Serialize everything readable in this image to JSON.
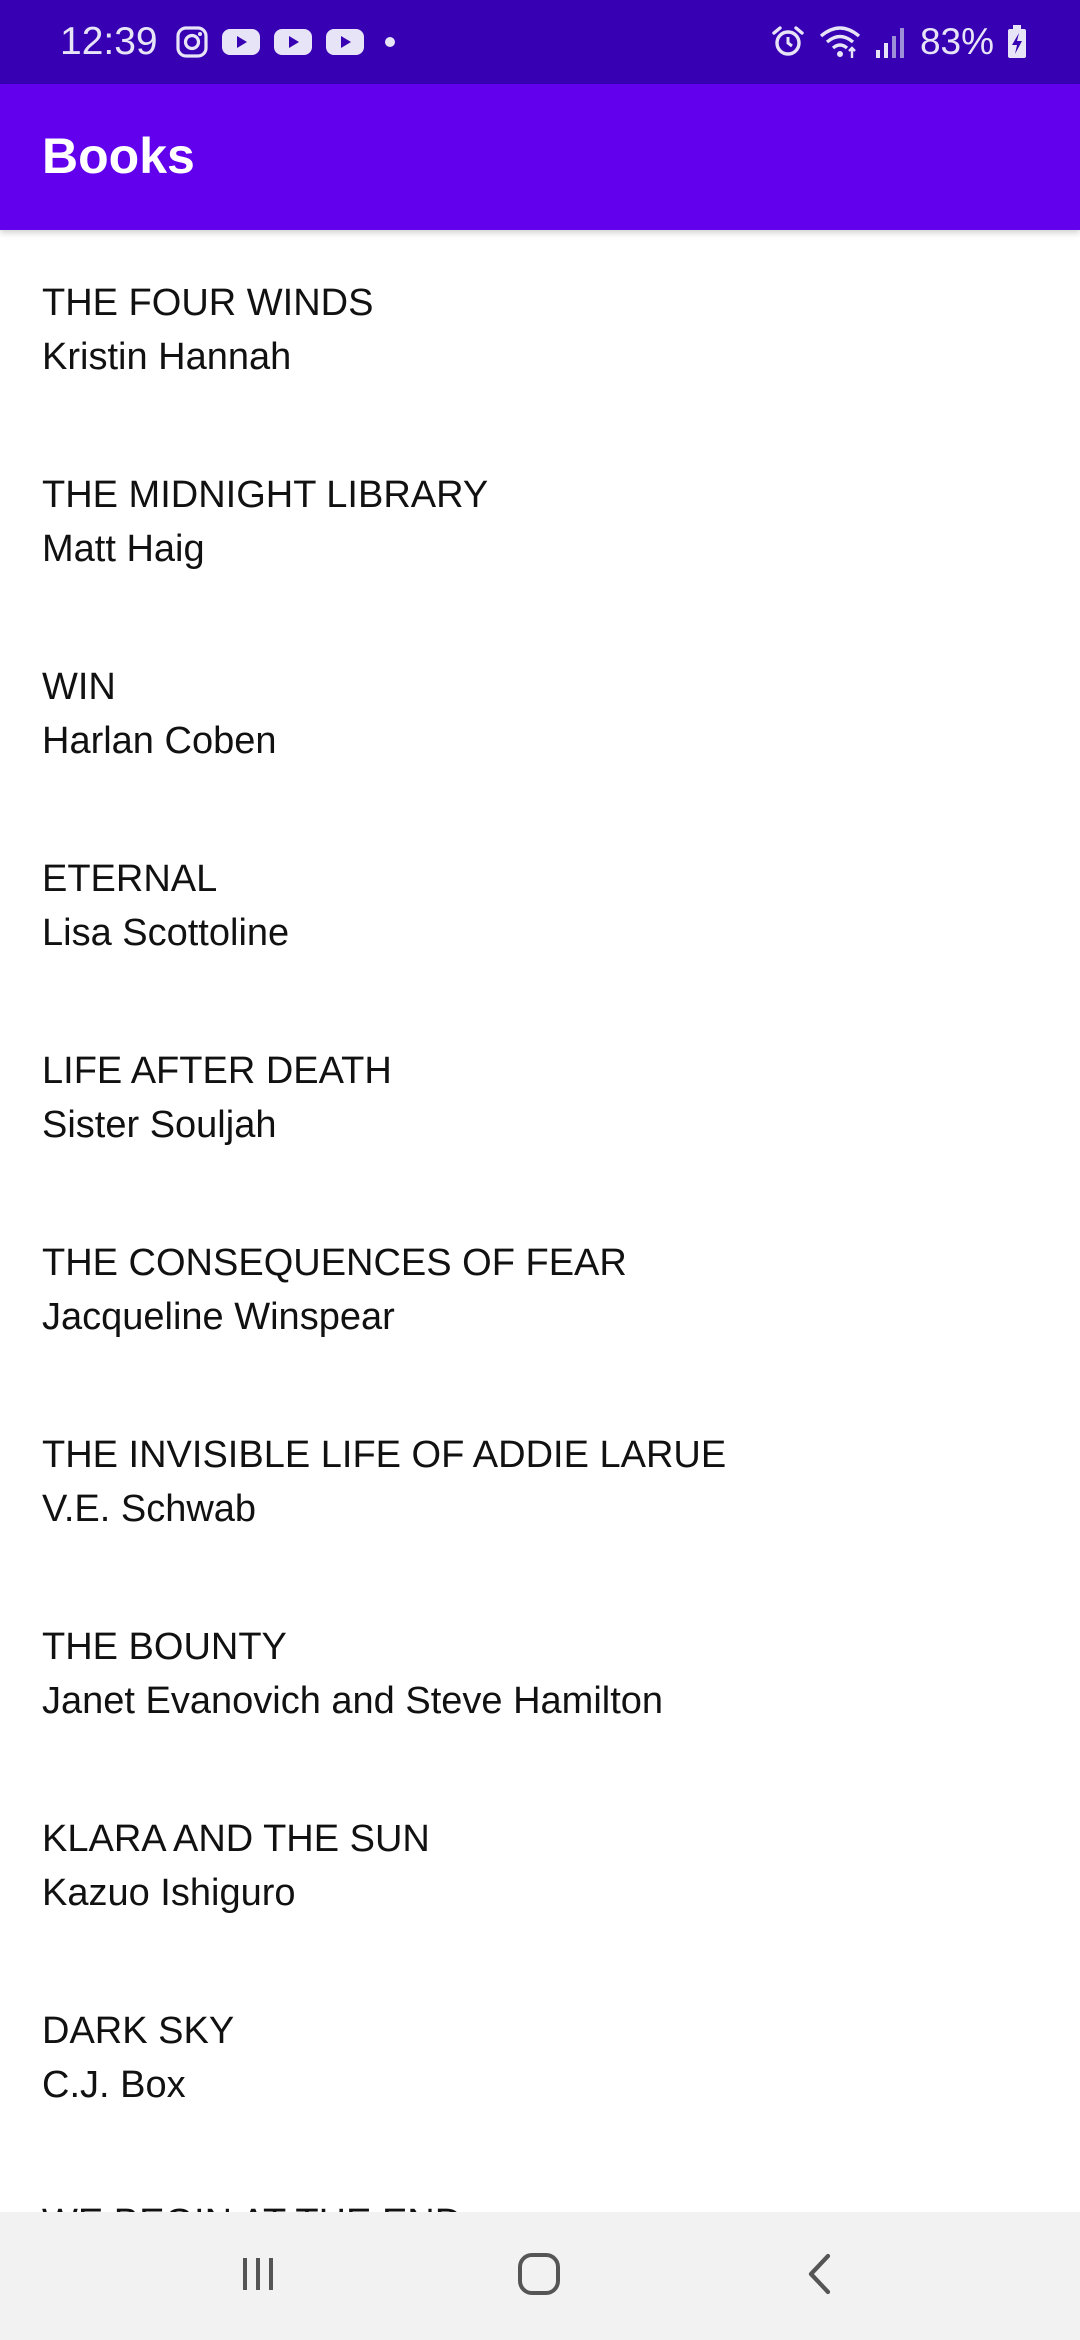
{
  "status_bar": {
    "time": "12:39",
    "battery_percent": "83%",
    "left_icons": [
      "instagram-icon",
      "youtube-icon",
      "youtube-icon",
      "youtube-icon",
      "dot-icon"
    ],
    "right_icons": [
      "alarm-icon",
      "wifi-icon",
      "signal-icon",
      "battery-charging-icon"
    ]
  },
  "app_bar": {
    "title": "Books",
    "color": "#6200EE",
    "status_color": "#3700B3"
  },
  "books": [
    {
      "title": "THE FOUR WINDS",
      "author": "Kristin Hannah"
    },
    {
      "title": "THE MIDNIGHT LIBRARY",
      "author": "Matt Haig"
    },
    {
      "title": "WIN",
      "author": "Harlan Coben"
    },
    {
      "title": "ETERNAL",
      "author": "Lisa Scottoline"
    },
    {
      "title": "LIFE AFTER DEATH",
      "author": "Sister Souljah"
    },
    {
      "title": "THE CONSEQUENCES OF FEAR",
      "author": "Jacqueline Winspear"
    },
    {
      "title": "THE INVISIBLE LIFE OF ADDIE LARUE",
      "author": "V.E. Schwab"
    },
    {
      "title": "THE BOUNTY",
      "author": "Janet Evanovich and Steve Hamilton"
    },
    {
      "title": "KLARA AND THE SUN",
      "author": "Kazuo Ishiguro"
    },
    {
      "title": "DARK SKY",
      "author": "C.J. Box"
    },
    {
      "title": "WE BEGIN AT THE END",
      "author": ""
    }
  ],
  "nav_bar": {
    "buttons": [
      "recents-icon",
      "home-icon",
      "back-icon"
    ]
  }
}
